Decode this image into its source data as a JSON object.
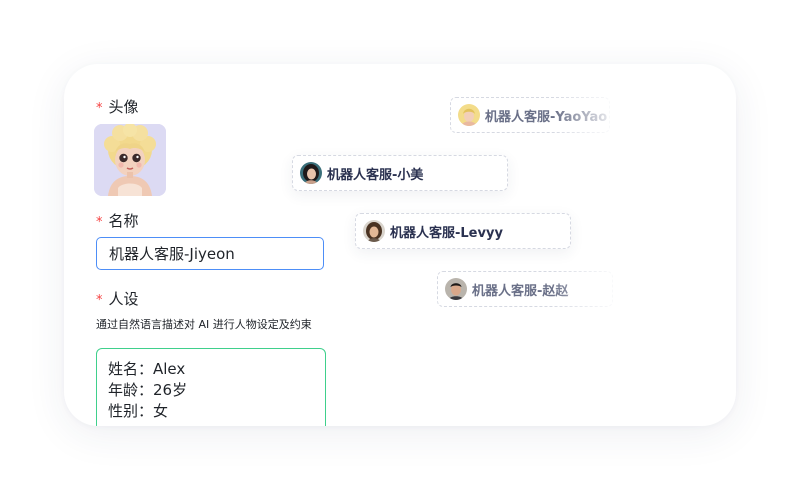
{
  "form": {
    "avatar_label": "头像",
    "name_label": "名称",
    "name_value": "机器人客服-Jiyeon",
    "persona_label": "人设",
    "persona_hint": "通过自然语言描述对 AI 进行人物设定及约束",
    "persona_lines": [
      "姓名：Alex",
      "年龄：26岁",
      "性别：女"
    ],
    "required_mark": "*"
  },
  "bots": [
    {
      "name": "机器人客服-YaoYao",
      "avatar": "blonde-woman-avatar"
    },
    {
      "name": "机器人客服-小美",
      "avatar": "dark-hair-woman-avatar"
    },
    {
      "name": "机器人客服-Levyy",
      "avatar": "brunette-woman-avatar"
    },
    {
      "name": "机器人客服-赵赵",
      "avatar": "man-avatar"
    }
  ],
  "colors": {
    "required": "#f53f3f",
    "name_input_border": "#4d8ef7",
    "persona_border": "#3fd08c"
  }
}
